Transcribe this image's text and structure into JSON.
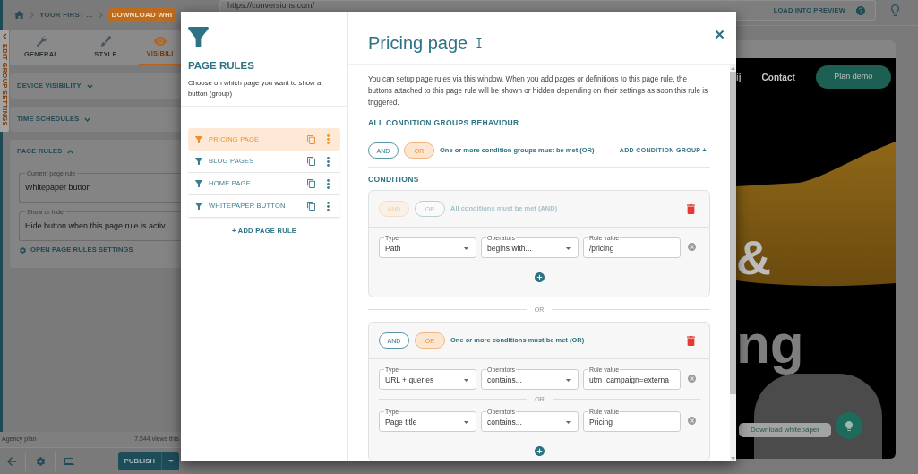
{
  "sidebar": {
    "side_tab": "EDIT GROUP SETTINGS",
    "breadcrumb": [
      "YOUR FIRST ..."
    ],
    "breadcrumb_button": "DOWNLOAD WHI",
    "tabs": [
      {
        "label": "GENERAL",
        "selected": false
      },
      {
        "label": "STYLE",
        "selected": false
      },
      {
        "label": "VISIBILI",
        "selected": true
      }
    ],
    "sections": [
      {
        "title": "DEVICE VISIBILITY",
        "expanded": false
      },
      {
        "title": "TIME SCHEDULES",
        "expanded": false
      },
      {
        "title": "PAGE RULES",
        "expanded": true,
        "fields": [
          {
            "label": "Current page rule",
            "value": "Whitepaper button"
          },
          {
            "label": "Show or hide",
            "value": "Hide button when this page rule is activ..."
          }
        ],
        "link": "OPEN PAGE RULES SETTINGS"
      }
    ],
    "footer": {
      "plan": "Agency plan",
      "views": "7.544 views this"
    },
    "publish": "PUBLISH"
  },
  "top_bar": {
    "url": "https://conversions.com/",
    "load_button": "LOAD INTO PREVIEW"
  },
  "preview": {
    "nav": [
      "ij",
      "Contact"
    ],
    "cta": "Plan demo",
    "headline": [
      "&",
      "ng"
    ],
    "whitepaper_button": "Download whitepaper"
  },
  "modal": {
    "rules_panel": {
      "title": "PAGE RULES",
      "description": "Choose on which page you want to show a button (group)",
      "rules": [
        {
          "label": "PRICING PAGE",
          "selected": true
        },
        {
          "label": "BLOG PAGES",
          "selected": false
        },
        {
          "label": "HOME PAGE",
          "selected": false
        },
        {
          "label": "WHITEPAPER BUTTON",
          "selected": false
        }
      ],
      "add_rule": "+ ADD PAGE RULE"
    },
    "detail": {
      "title": "Pricing page",
      "intro": "You can setup page rules via this window. When you add pages or definitions to this page rule, the buttons attached to this page rule will be shown or hidden depending on their settings as soon this rule is triggered.",
      "behaviour": {
        "heading": "ALL CONDITION GROUPS BEHAVIOUR",
        "options": [
          {
            "label": "AND",
            "selected": false
          },
          {
            "label": "OR",
            "selected": true
          }
        ],
        "summary": "One or more condition groups must be met (OR)",
        "add_group": "ADD CONDITION GROUP +"
      },
      "conditions_heading": "CONDITIONS",
      "groups": [
        {
          "disabled": true,
          "options": [
            {
              "label": "AND",
              "selected": true
            },
            {
              "label": "OR",
              "selected": false
            }
          ],
          "summary": "All conditions must be met (AND)",
          "conditions": [
            {
              "fields": [
                {
                  "kind": "select",
                  "label": "Type",
                  "value": "Path"
                },
                {
                  "kind": "select",
                  "label": "Operators",
                  "value": "begins with..."
                },
                {
                  "kind": "input",
                  "label": "Rule value",
                  "value": "/pricing"
                }
              ]
            }
          ]
        },
        {
          "separator": "OR",
          "disabled": false,
          "options": [
            {
              "label": "AND",
              "selected": false
            },
            {
              "label": "OR",
              "selected": true
            }
          ],
          "summary": "One or more conditions must be met (OR)",
          "conditions": [
            {
              "fields": [
                {
                  "kind": "select",
                  "label": "Type",
                  "value": "URL + queries"
                },
                {
                  "kind": "select",
                  "label": "Operators",
                  "value": "contains..."
                },
                {
                  "kind": "input",
                  "label": "Rule value",
                  "value": "utm_campaign=externa"
                }
              ]
            },
            {
              "separator": "OR",
              "fields": [
                {
                  "kind": "select",
                  "label": "Type",
                  "value": "Page title"
                },
                {
                  "kind": "select",
                  "label": "Operators",
                  "value": "contains..."
                },
                {
                  "kind": "input",
                  "label": "Rule value",
                  "value": "Pricing"
                }
              ]
            }
          ]
        }
      ]
    }
  }
}
